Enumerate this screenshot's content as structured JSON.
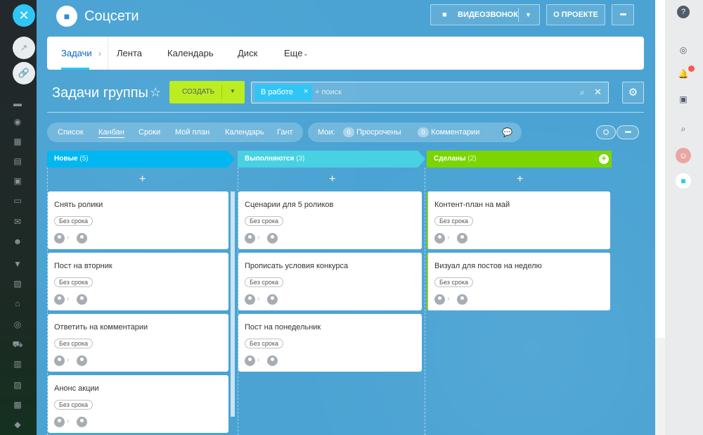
{
  "header": {
    "title": "Соцсети",
    "video_call": "ВИДЕОЗВОНОК",
    "about": "О ПРОЕКТЕ",
    "more": "•••"
  },
  "nav": {
    "items": [
      "Задачи",
      "Лента",
      "Календарь",
      "Диск",
      "Еще"
    ],
    "active": "Задачи"
  },
  "toolbar": {
    "page_title": "Задачи группы",
    "create_label": "СОЗДАТЬ",
    "filter_tag": "В работе",
    "search_placeholder": "+ поиск"
  },
  "views": {
    "tabs": [
      "Список",
      "Канбан",
      "Сроки",
      "Мой план",
      "Календарь",
      "Гант"
    ],
    "active": "Канбан",
    "mine_label": "Мои:",
    "overdue_count": "0",
    "overdue_label": "Просрочены",
    "comments_count": "0",
    "comments_label": "Комментарии"
  },
  "columns": [
    {
      "title": "Новые",
      "count": "(5)",
      "color": "#00b7f1",
      "cards": [
        {
          "title": "Снять ролики",
          "badge": "Без срока"
        },
        {
          "title": "Пост на вторник",
          "badge": "Без срока"
        },
        {
          "title": "Ответить на комментарии",
          "badge": "Без срока"
        },
        {
          "title": "Анонс акции",
          "badge": "Без срока"
        }
      ]
    },
    {
      "title": "Выполняются",
      "count": "(3)",
      "color": "#47d1e2",
      "cards": [
        {
          "title": "Сценарии для 5 роликов",
          "badge": "Без срока"
        },
        {
          "title": "Прописать условия конкурса",
          "badge": "Без срока"
        },
        {
          "title": "Пост на понедельник",
          "badge": "Без срока"
        }
      ]
    },
    {
      "title": "Сделаны",
      "count": "(2)",
      "color": "#7bd500",
      "cards": [
        {
          "title": "Контент-план на май",
          "badge": "Без срока"
        },
        {
          "title": "Визуал для постов на неделю",
          "badge": "Без срока"
        }
      ]
    }
  ],
  "colors": {
    "accent": "#2fc6f6",
    "create": "#bbed21",
    "background": "#4aa3d3"
  }
}
